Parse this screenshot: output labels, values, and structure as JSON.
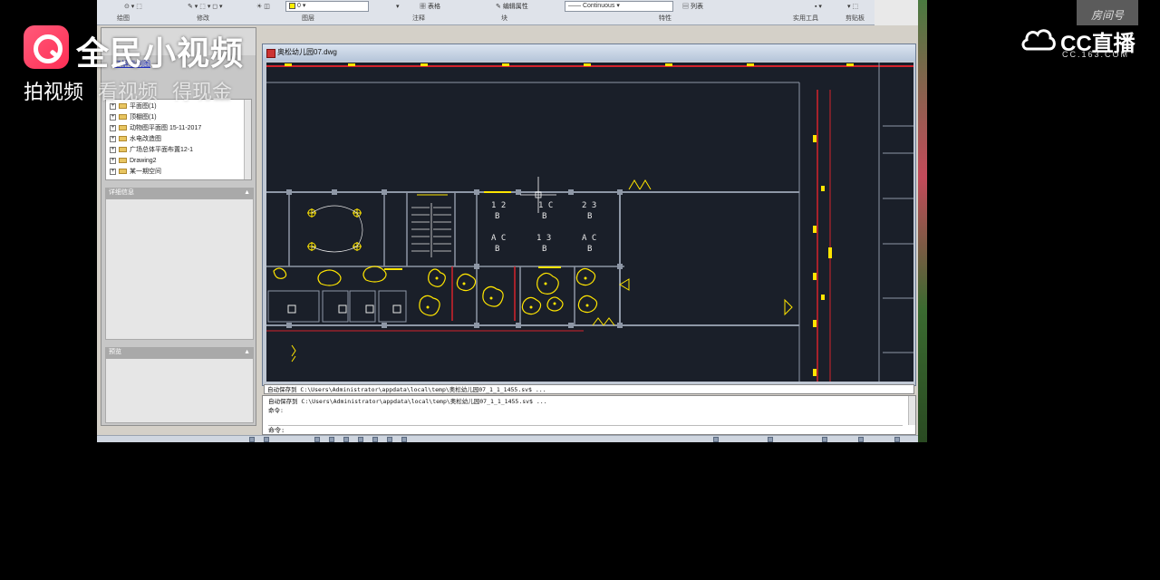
{
  "overlay": {
    "brand_title": "全民小视频",
    "slogan": [
      "拍视频",
      "看视频",
      "得现金"
    ],
    "room_badge": "房间号",
    "cc_text": "CC直播",
    "cc_domain": "CC.163.COM"
  },
  "ribbon": {
    "groups": [
      "绘图",
      "修改",
      "图层",
      "注释",
      "块",
      "特性",
      "实用工具",
      "剪贴板"
    ],
    "layer_value": "0",
    "table_label": "表格",
    "match_label": "编辑属性",
    "linetype_value": "Continuous",
    "list_label": "列表"
  },
  "palette": {
    "link": "了解示例图",
    "tree_items": [
      "平面图(1)",
      "顶棚图(1)",
      "动物图平面图 15-11-2017",
      "水电改造图",
      "广场总体平面布置12-1",
      "Drawing2",
      "某一期空间"
    ],
    "section_detail": "详细信息",
    "section_preview": "预览"
  },
  "drawing": {
    "title": "奥松幼儿园07.dwg",
    "colors": {
      "wall": "#8e97a6",
      "yellow": "#ffe500",
      "red": "#d4232c",
      "white": "#e8e8e8",
      "bg": "#1a1f29"
    }
  },
  "command": {
    "line1": "自动保存到 C:\\Users\\Administrator\\appdata\\local\\temp\\奥松幼儿园07_1_1_1455.sv$ ...",
    "line2": "自动保存到 C:\\Users\\Administrator\\appdata\\local\\temp\\奥松幼儿园07_1_1_1455.sv$ ...",
    "line3": "命令:",
    "prompt": "命令:"
  }
}
